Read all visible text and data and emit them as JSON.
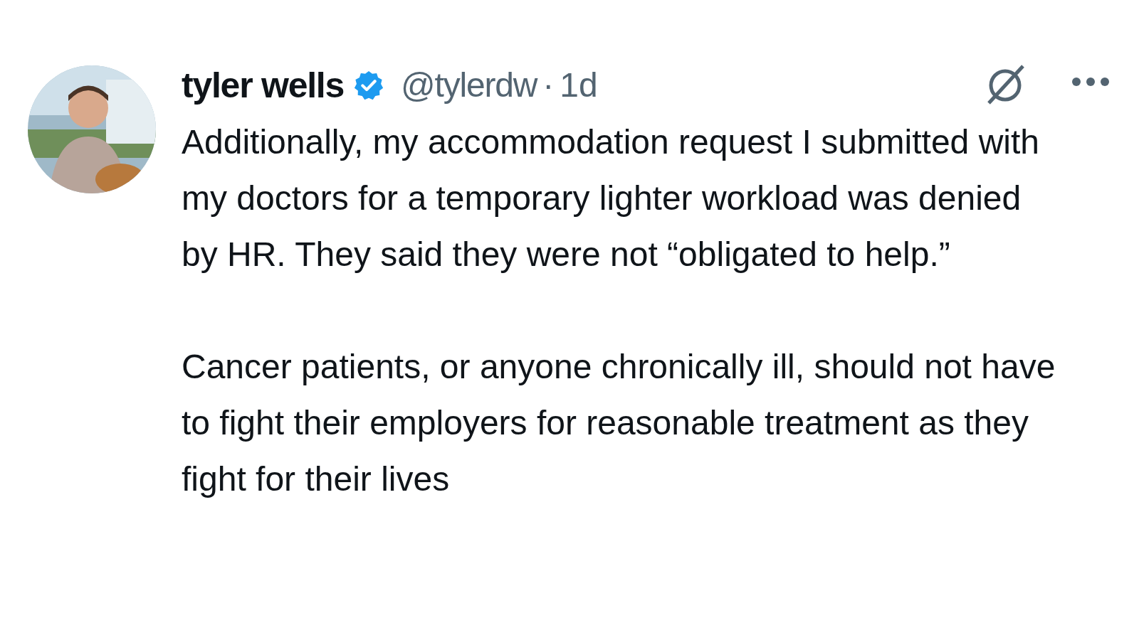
{
  "post": {
    "author": {
      "name": "tyler wells",
      "verified": true,
      "handle": "@tylerdw",
      "separator": "·",
      "time": "1d"
    },
    "paragraphs": [
      "Additionally, my accommodation request I submitted with my doctors for a temporary lighter workload was denied by HR. They said they were not “obligated to help.”",
      "Cancer patients, or anyone chronically ill, should not have to fight their employers for reasonable treatment as they fight for their lives"
    ]
  }
}
